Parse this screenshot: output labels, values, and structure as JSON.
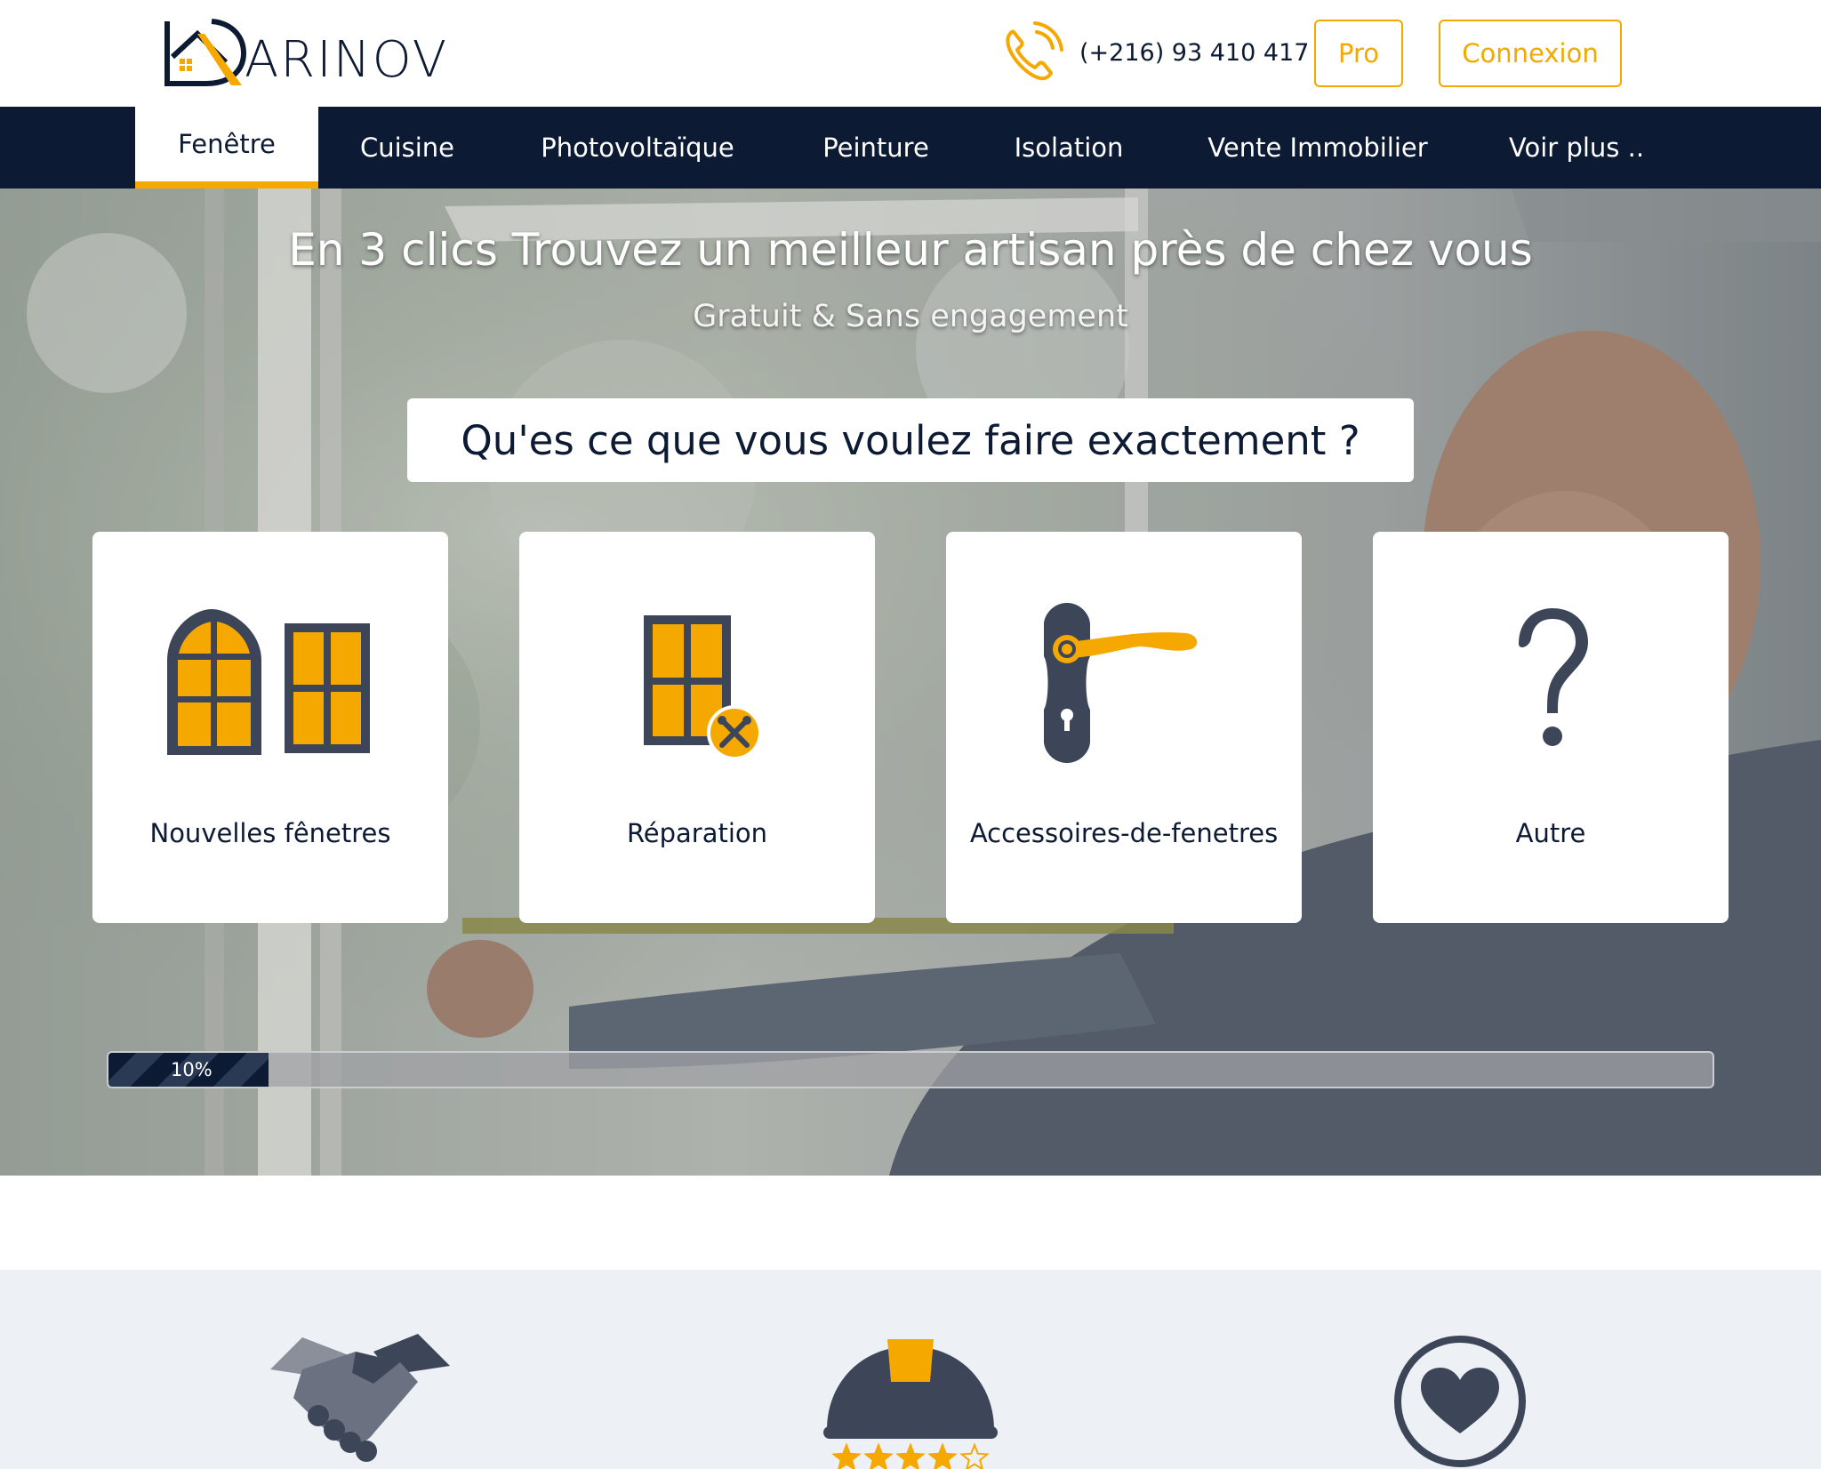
{
  "header": {
    "logo_text": "ARINOV",
    "phone": "(+216) 93 410 417",
    "pro_label": "Pro",
    "login_label": "Connexion"
  },
  "nav": {
    "items": [
      {
        "label": "Fenêtre",
        "active": true
      },
      {
        "label": "Cuisine"
      },
      {
        "label": "Photovoltaïque"
      },
      {
        "label": "Peinture"
      },
      {
        "label": "Isolation"
      },
      {
        "label": "Vente Immobilier"
      },
      {
        "label": "Voir plus .."
      }
    ]
  },
  "hero": {
    "title": "En 3 clics Trouvez un meilleur artisan près de chez vous",
    "subtitle": "Gratuit & Sans engagement",
    "question": "Qu'es ce que vous voulez faire exactement ?",
    "options": [
      {
        "label": "Nouvelles fênetres",
        "icon": "windows-icon"
      },
      {
        "label": "Réparation",
        "icon": "window-repair-icon"
      },
      {
        "label": "Accessoires-de-fenetres",
        "icon": "door-handle-icon"
      },
      {
        "label": "Autre",
        "icon": "question-mark-icon"
      }
    ],
    "progress": {
      "value": 10,
      "label": "10%"
    }
  },
  "features": {
    "icons": [
      "handshake-icon",
      "helmet-rating-icon",
      "heart-icon"
    ],
    "rating": {
      "value": 4,
      "max": 5
    }
  },
  "colors": {
    "navy": "#0c1a33",
    "accent": "#f5a800",
    "slate": "#3d4659"
  }
}
